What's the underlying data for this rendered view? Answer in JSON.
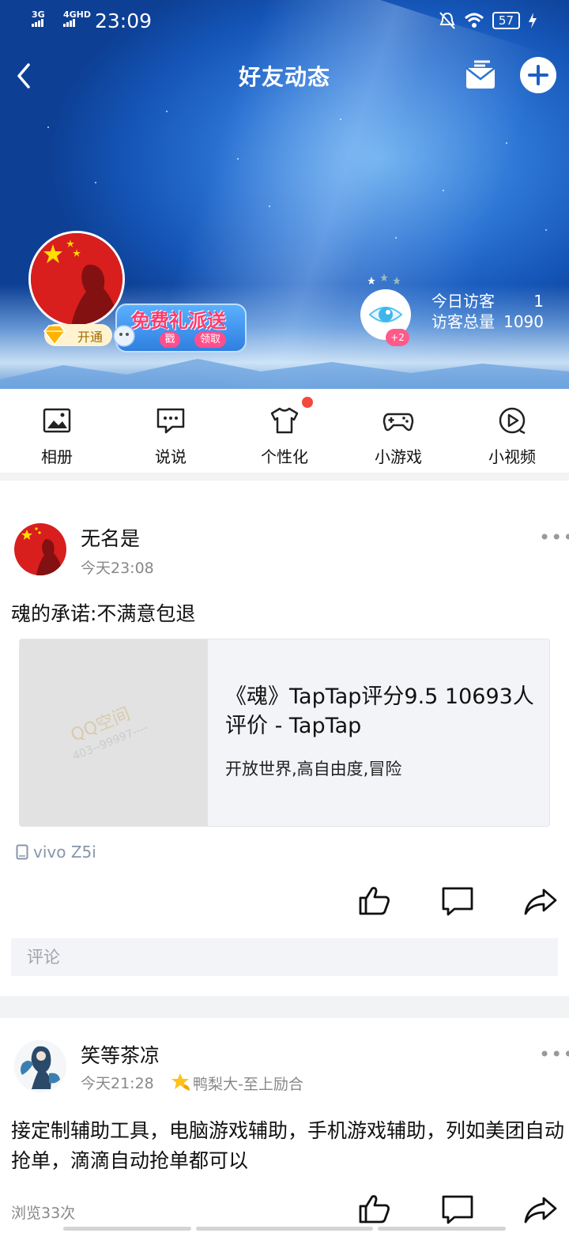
{
  "status_bar": {
    "signal_1": "3G",
    "signal_2": "4GHD",
    "time": "23:09",
    "battery": "57"
  },
  "header": {
    "title": "好友动态",
    "vip_label": "开通",
    "gift_title": "免费礼派送",
    "gift_btn_1": "戳",
    "gift_btn_2": "领取",
    "eye_badge": "+2",
    "visitors_today_label": "今日访客",
    "visitors_today_value": "1",
    "visitors_total_label": "访客总量",
    "visitors_total_value": "1090"
  },
  "nav": {
    "items": [
      {
        "label": "相册",
        "icon": "photo-album-icon"
      },
      {
        "label": "说说",
        "icon": "chat-bubble-icon"
      },
      {
        "label": "个性化",
        "icon": "tshirt-icon"
      },
      {
        "label": "小游戏",
        "icon": "gamepad-icon"
      },
      {
        "label": "小视频",
        "icon": "video-play-icon"
      }
    ]
  },
  "posts": [
    {
      "name": "无名是",
      "time": "今天23:08",
      "text": "魂的承诺:不满意包退",
      "link": {
        "thumb_watermark": "QQ空间",
        "thumb_watermark_sub": "403--99997----",
        "title": "《魂》TapTap评分9.5 10693人评价 - TapTap",
        "subtitle": "开放世界,高自由度,冒险"
      },
      "device": "vivo Z5i",
      "comment_placeholder": "评论"
    },
    {
      "name": "笑等茶凉",
      "time": "今天21:28",
      "badge": "鸭梨大-至上励合",
      "text": "接定制辅助工具，电脑游戏辅助，手机游戏辅助，列如美团自动抢单，滴滴自动抢单都可以",
      "views": "浏览33次"
    }
  ],
  "colors": {
    "sky": "#2c74d4",
    "accent_red": "#f24a3c",
    "gray_text": "#888888",
    "device_text": "#8895ab"
  }
}
